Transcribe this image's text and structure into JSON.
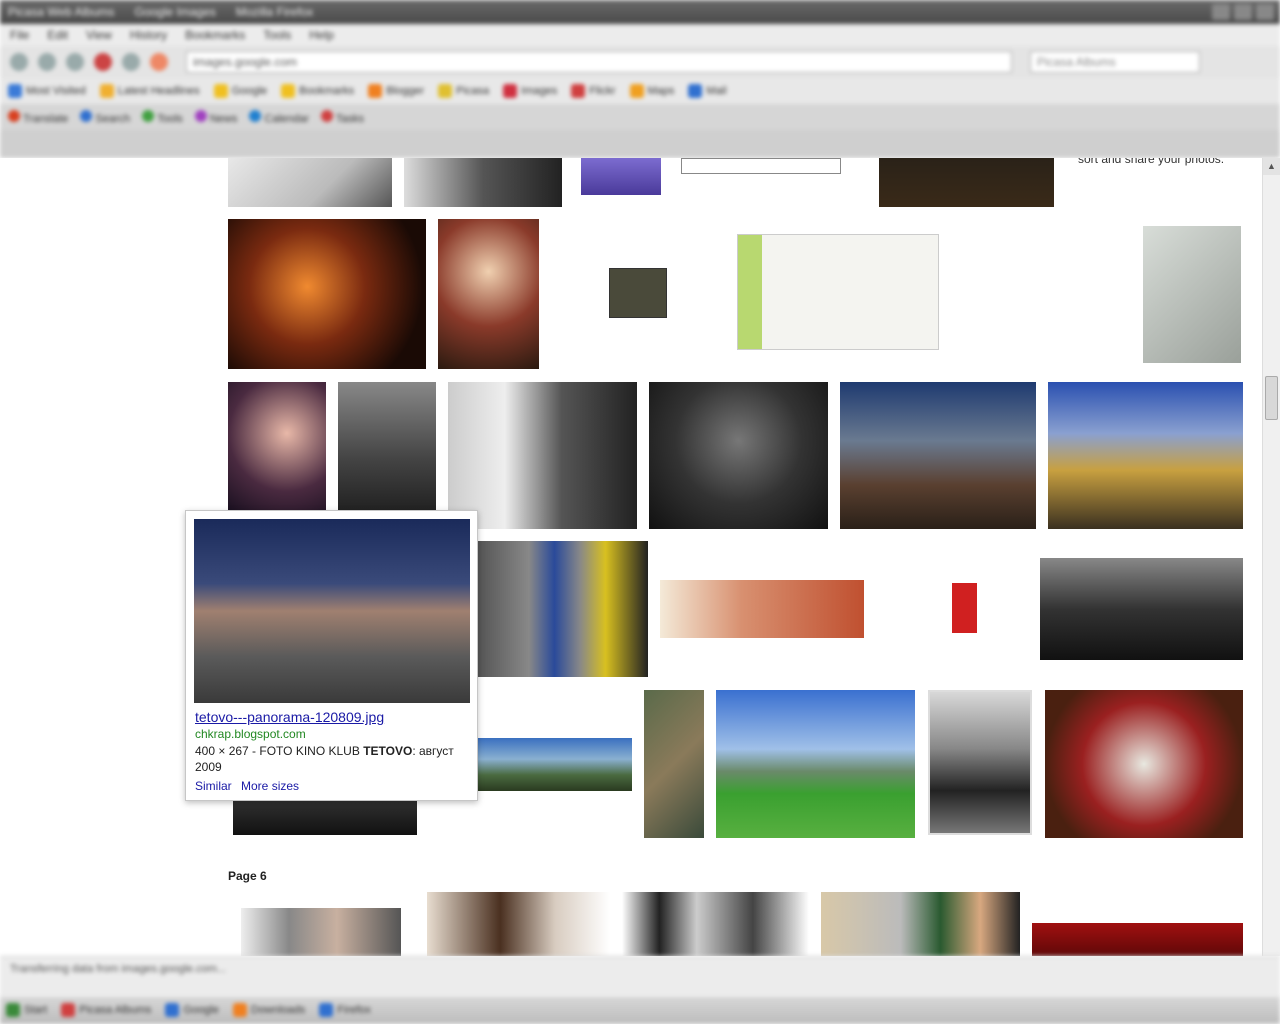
{
  "browser": {
    "title_items": [
      "Picasa Web Albums",
      "Google Images",
      "Mozilla Firefox"
    ],
    "menu_items": [
      "File",
      "Edit",
      "View",
      "History",
      "Bookmarks",
      "Tools",
      "Help"
    ],
    "url": "images.google.com",
    "search_placeholder": "Picasa Albums",
    "bookmarks": [
      {
        "label": "Most Visited",
        "color": "#3b7bd8"
      },
      {
        "label": "Latest Headlines",
        "color": "#f0b030"
      },
      {
        "label": "Google",
        "color": "#f0c020"
      },
      {
        "label": "Bookmarks",
        "color": "#f0c020"
      },
      {
        "label": "Blogger",
        "color": "#f08020"
      },
      {
        "label": "Picasa",
        "color": "#e0c030"
      },
      {
        "label": "Images",
        "color": "#d03040"
      },
      {
        "label": "Flickr",
        "color": "#d04040"
      },
      {
        "label": "Maps",
        "color": "#f0a020"
      },
      {
        "label": "Mail",
        "color": "#3070d0"
      }
    ],
    "tabs": [
      {
        "label": "Translate",
        "color": "#d84020"
      },
      {
        "label": "Search",
        "color": "#3070d0"
      },
      {
        "label": "Tools",
        "color": "#40a040"
      },
      {
        "label": "News",
        "color": "#a040c0"
      },
      {
        "label": "Calendar",
        "color": "#2080d0"
      },
      {
        "label": "Tasks",
        "color": "#d04040"
      }
    ]
  },
  "content": {
    "top_text": "sort and share your photos.",
    "page_label": "Page 6"
  },
  "popup": {
    "title": "tetovo---panorama-120809.jpg",
    "site": "chkrap.blogspot.com",
    "desc_prefix": "400 × 267 - FOTO KINO KLUB ",
    "desc_bold": "TETOVO",
    "desc_suffix": ": август 2009",
    "link_similar": "Similar",
    "link_more_sizes": "More sizes"
  },
  "status": {
    "text": "Transferring data from images.google.com..."
  },
  "taskbar": [
    {
      "label": "Start",
      "color": "#3a8a3a"
    },
    {
      "label": "Picasa Albums",
      "color": "#d04040"
    },
    {
      "label": "Google",
      "color": "#3070d0"
    },
    {
      "label": "Downloads",
      "color": "#f08020"
    },
    {
      "label": "Firefox",
      "color": "#3070d0"
    }
  ]
}
